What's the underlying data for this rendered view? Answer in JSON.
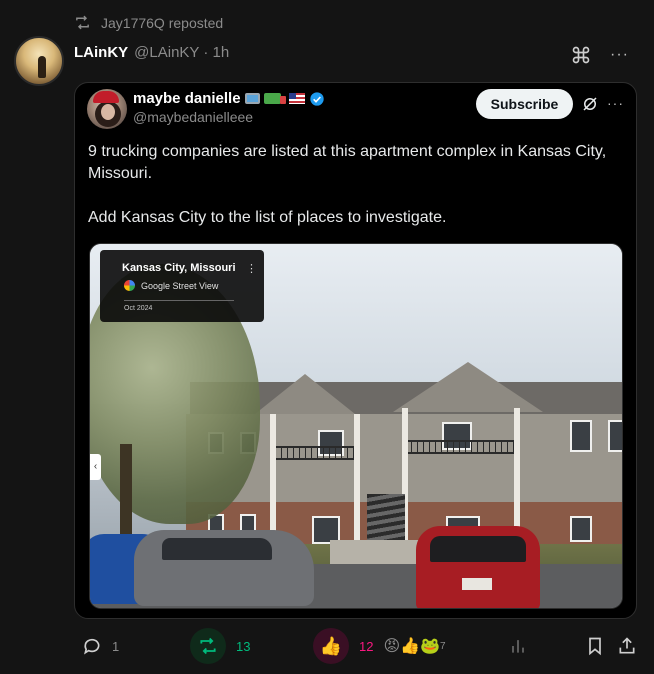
{
  "repost": {
    "text": "Jay1776Q reposted",
    "icon": "repost-icon"
  },
  "post": {
    "author_name": "LAinKY",
    "handle_time": "@LAinKY · 1h",
    "more": "···"
  },
  "quote": {
    "author_name": "maybe danielle",
    "author_emojis": [
      "laptop",
      "truck",
      "us-flag"
    ],
    "handle": "@maybedanielleee",
    "subscribe_label": "Subscribe",
    "more": "···",
    "text_line1": "9 trucking companies are listed at this apartment complex in Kansas City, Missouri.",
    "text_line2": "Add Kansas City to the list of places to investigate.",
    "image": {
      "label_title": "Kansas City, Missouri",
      "label_source": "Google Street View",
      "label_date": "Oct 2024",
      "label_more": "⋮",
      "side_tab": "‹"
    }
  },
  "actions": {
    "replies": "1",
    "reposts": "13",
    "likes": "12",
    "react_count": "7"
  },
  "colors": {
    "background": "#141414",
    "accent_green": "#00ba7c",
    "accent_pink": "#f91880",
    "verified_blue": "#1d9bf0"
  }
}
